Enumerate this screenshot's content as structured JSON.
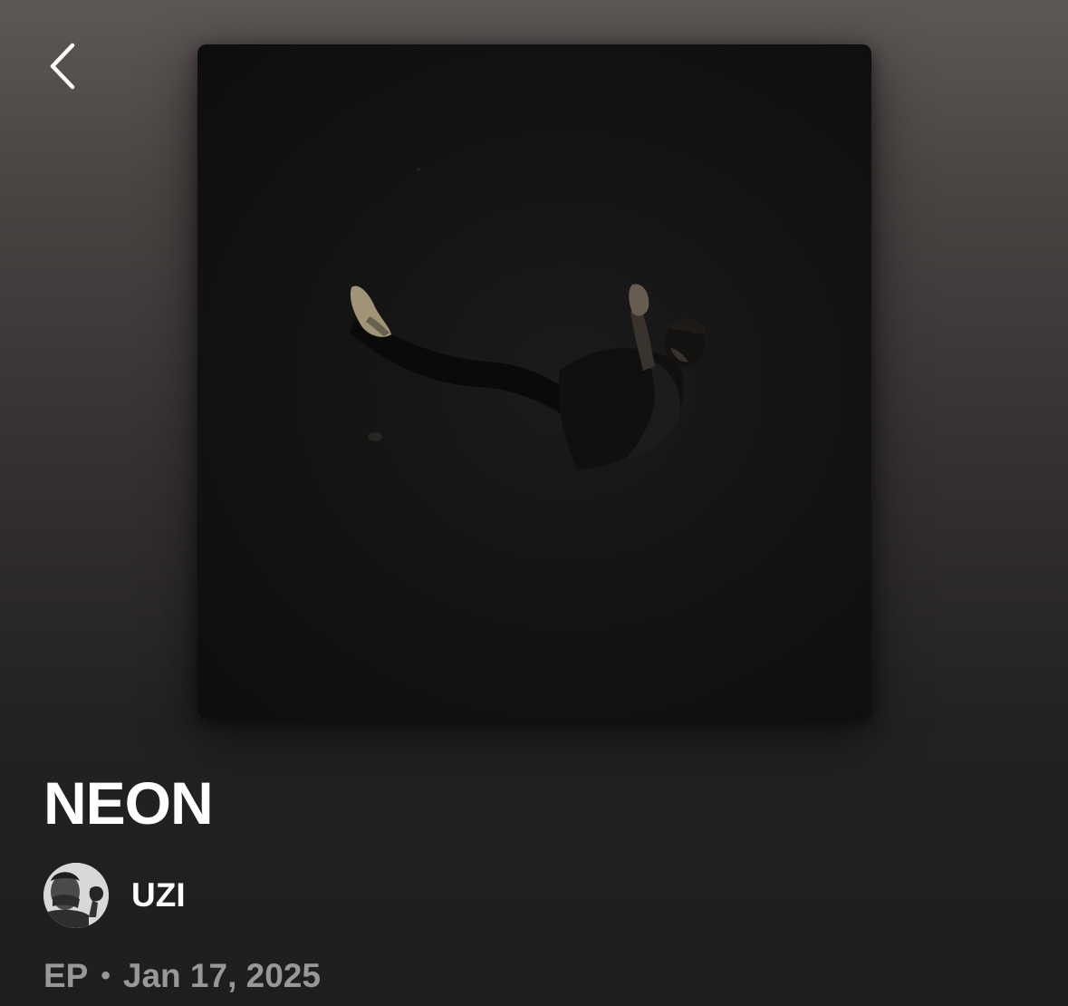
{
  "header": {
    "back_icon": "chevron-left-icon"
  },
  "cover": {
    "description_icon": "album-cover-art"
  },
  "album": {
    "title": "NEON"
  },
  "artist": {
    "name": "UZI",
    "avatar_icon": "artist-avatar"
  },
  "meta": {
    "type": "EP",
    "separator": "•",
    "release_date": "Jan 17, 2025"
  },
  "colors": {
    "background_top": "#5d5756",
    "background_bottom": "#1f1e1e",
    "title_text": "#ffffff",
    "meta_text": "#9a9797",
    "cover_background": "#111111"
  }
}
